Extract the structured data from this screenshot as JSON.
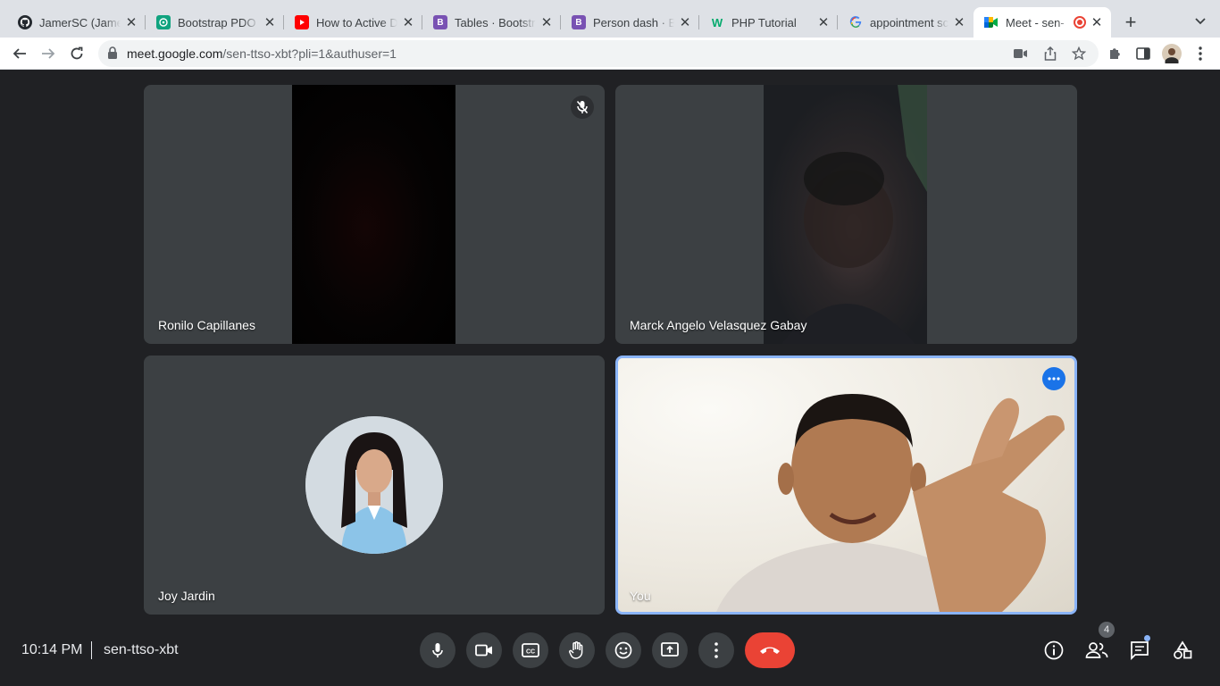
{
  "browser": {
    "tabs": [
      {
        "title": "JamerSC (James",
        "favicon": "github-icon",
        "color": "#24292f"
      },
      {
        "title": "Bootstrap PDO",
        "favicon": "openai-icon",
        "color": "#10a37f"
      },
      {
        "title": "How to Active D",
        "favicon": "youtube-icon",
        "color": "#ff0000"
      },
      {
        "title": "Tables · Bootstr",
        "favicon": "bootstrap-icon",
        "color": "#7952b3"
      },
      {
        "title": "Person dash · B",
        "favicon": "bootstrap-icon",
        "color": "#7952b3"
      },
      {
        "title": "PHP Tutorial",
        "favicon": "w3schools-icon",
        "color": "#04aa6d"
      },
      {
        "title": "appointment sc",
        "favicon": "google-icon",
        "color": "#4285f4"
      },
      {
        "title": "Meet - sen-",
        "favicon": "google-meet-icon",
        "color": "#00832d"
      }
    ],
    "url_host": "meet.google.com",
    "url_path": "/sen-ttso-xbt?pli=1&authuser=1"
  },
  "meet": {
    "participants": [
      {
        "name": "Ronilo Capillanes",
        "muted": true
      },
      {
        "name": "Marck Angelo Velasquez Gabay",
        "muted": false
      },
      {
        "name": "Joy Jardin",
        "muted": false
      },
      {
        "name": "You",
        "muted": false
      }
    ],
    "time": "10:14 PM",
    "meeting_code": "sen-ttso-xbt",
    "people_count": "4",
    "end_call_color": "#ea4335",
    "active_speaker_border": "#8ab4f8"
  }
}
